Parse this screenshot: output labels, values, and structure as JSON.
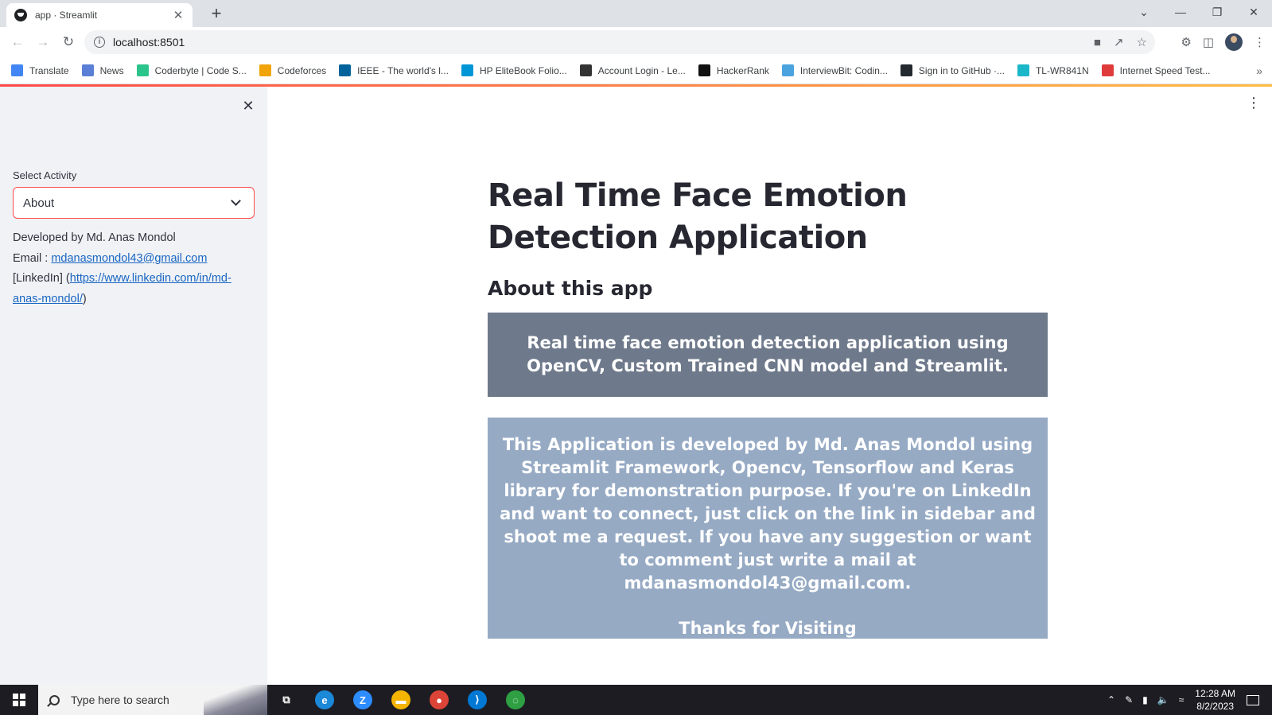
{
  "browser": {
    "tab_title": "app · Streamlit",
    "tab_close": "✕",
    "new_tab": "+",
    "url": "localhost:8501",
    "window_controls": [
      "⌄",
      "—",
      "❐",
      "✕"
    ],
    "bookmarks": [
      {
        "label": "Translate",
        "icon": "translate-icon",
        "color": "#4285f4"
      },
      {
        "label": "News",
        "icon": "news-icon",
        "color": "#5b7fd6"
      },
      {
        "label": "Coderbyte | Code S...",
        "icon": "coderbyte-icon",
        "color": "#2bc48a"
      },
      {
        "label": "Codeforces",
        "icon": "codeforces-icon",
        "color": "#f0a30a"
      },
      {
        "label": "IEEE - The world's l...",
        "icon": "ieee-icon",
        "color": "#00629b"
      },
      {
        "label": "HP EliteBook Folio...",
        "icon": "hp-icon",
        "color": "#0096d6"
      },
      {
        "label": "Account Login - Le...",
        "icon": "account-icon",
        "color": "#333333"
      },
      {
        "label": "HackerRank",
        "icon": "hackerrank-icon",
        "color": "#111111"
      },
      {
        "label": "InterviewBit: Codin...",
        "icon": "interviewbit-icon",
        "color": "#4aa3df"
      },
      {
        "label": "Sign in to GitHub ·...",
        "icon": "github-icon",
        "color": "#24292f"
      },
      {
        "label": "TL-WR841N",
        "icon": "tplink-icon",
        "color": "#19b7c8"
      },
      {
        "label": "Internet Speed Test...",
        "icon": "speedtest-icon",
        "color": "#e03b3b"
      }
    ],
    "bookmarks_overflow": "»"
  },
  "sidebar": {
    "close": "✕",
    "select_label": "Select Activity",
    "select_value": "About",
    "developed_by": "Developed by Md. Anas Mondol",
    "email_label": "Email : ",
    "email_link": "mdanasmondol43@gmail.com",
    "linkedin_prefix": "[LinkedIn] (",
    "linkedin_link": "https://www.linkedin.com/in/md-anas-mondol/",
    "linkedin_suffix": ")"
  },
  "main": {
    "menu": "⋮",
    "title": "Real Time Face Emotion Detection Application",
    "subheader": "About this app",
    "box1_text": "Real time face emotion detection application using OpenCV, Custom Trained CNN model and Streamlit.",
    "box2_text": "This Application is developed by Md. Anas Mondol using Streamlit Framework, Opencv, Tensorflow and Keras library for demonstration purpose. If you're on LinkedIn and want to connect, just click on the link in sidebar and shoot me a request. If you have any suggestion or want to comment just write a mail at mdanasmondol43@gmail.com.",
    "box2_thanks": "Thanks for Visiting",
    "box1_color": "#6e798b",
    "box2_color": "#96aac4"
  },
  "taskbar": {
    "search_placeholder": "Type here to search",
    "apps": [
      {
        "icon": "task-view-icon",
        "glyph": "⧉",
        "color": "#1c1c22"
      },
      {
        "icon": "edge-icon",
        "glyph": "e",
        "color": "#1b88d8"
      },
      {
        "icon": "zoom-icon",
        "glyph": "Z",
        "color": "#2d8cff"
      },
      {
        "icon": "file-explorer-icon",
        "glyph": "▬",
        "color": "#f4b400"
      },
      {
        "icon": "chrome-icon",
        "glyph": "●",
        "color": "#db4437"
      },
      {
        "icon": "vscode-icon",
        "glyph": "⟩",
        "color": "#0078d4"
      },
      {
        "icon": "app-ring-icon",
        "glyph": "◌",
        "color": "#2ea043"
      }
    ],
    "time": "12:28 AM",
    "date": "8/2/2023"
  }
}
